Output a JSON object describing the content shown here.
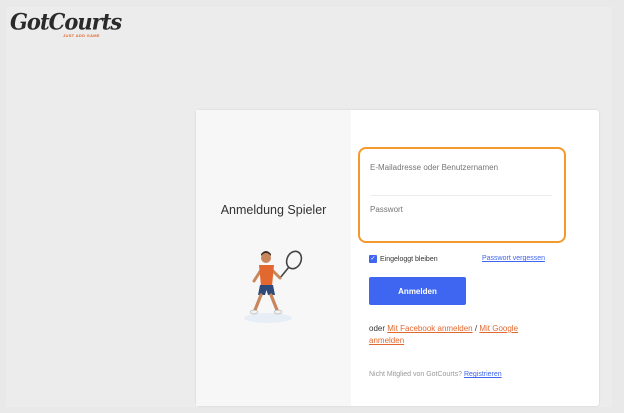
{
  "logo": {
    "wordmark": "GotCourts",
    "tagline": "JUST ADD GAME"
  },
  "left_panel": {
    "title": "Anmeldung Spieler",
    "illustration": "tennis-player-icon"
  },
  "form": {
    "email_placeholder": "E-Mailadresse oder Benutzernamen",
    "password_placeholder": "Passwort",
    "highlight_color": "#f39a2c"
  },
  "remember": {
    "label": "Eingeloggt bleiben",
    "checked": true
  },
  "forgot_link": "Passwort vergessen",
  "login_button": "Anmelden",
  "social": {
    "prefix": "oder",
    "facebook": "Mit Facebook anmelden",
    "separator": "/",
    "google": "Mit Google anmelden"
  },
  "register": {
    "prefix": "Nicht Mitglied von GotCourts?",
    "link": "Registrieren"
  },
  "colors": {
    "primary": "#3f66f0",
    "accent": "#e2682f"
  }
}
